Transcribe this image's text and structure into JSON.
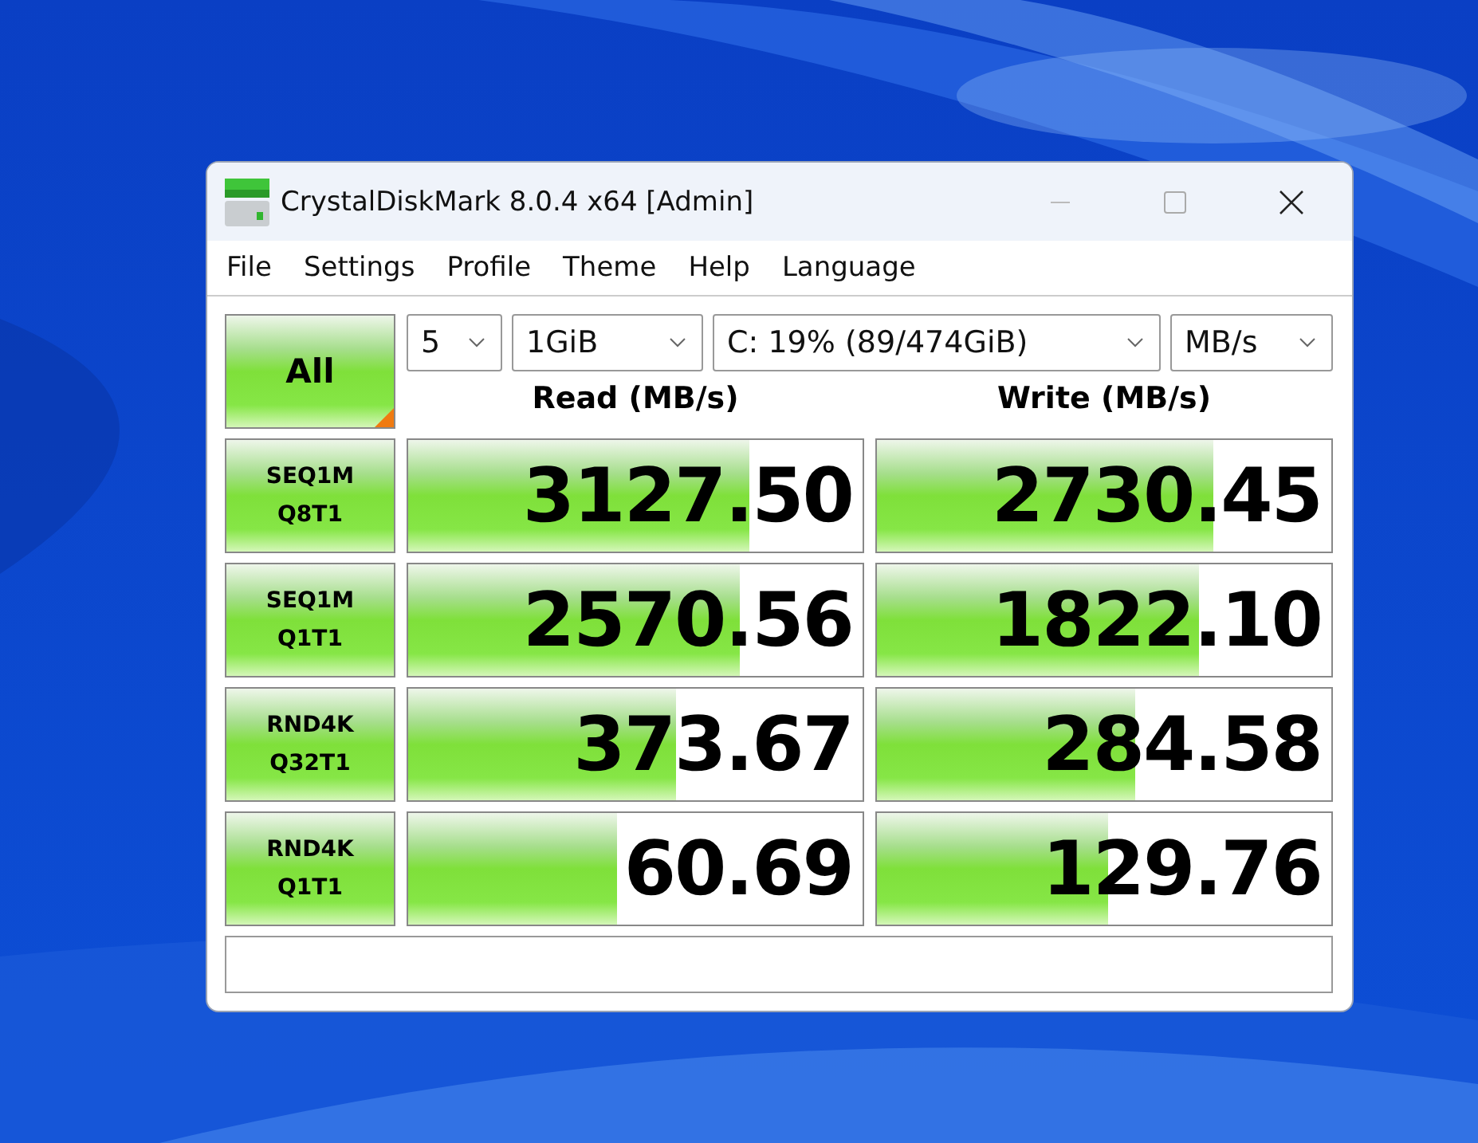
{
  "window": {
    "title": "CrystalDiskMark 8.0.4 x64 [Admin]"
  },
  "menu": [
    "File",
    "Settings",
    "Profile",
    "Theme",
    "Help",
    "Language"
  ],
  "all_button": {
    "label": "All"
  },
  "selects": [
    {
      "value": "5"
    },
    {
      "value": "1GiB"
    },
    {
      "value": "C: 19% (89/474GiB)"
    },
    {
      "value": "MB/s"
    }
  ],
  "headers": [
    "Read (MB/s)",
    "Write (MB/s)"
  ],
  "rows": [
    {
      "test": [
        "SEQ1M",
        "Q8T1"
      ],
      "read": {
        "value": "3127.50",
        "level": 0.75
      },
      "write": {
        "value": "2730.45",
        "level": 0.74
      }
    },
    {
      "test": [
        "SEQ1M",
        "Q1T1"
      ],
      "read": {
        "value": "2570.56",
        "level": 0.73
      },
      "write": {
        "value": "1822.10",
        "level": 0.71
      }
    },
    {
      "test": [
        "RND4K",
        "Q32T1"
      ],
      "read": {
        "value": "373.67",
        "level": 0.59
      },
      "write": {
        "value": "284.58",
        "level": 0.57
      }
    },
    {
      "test": [
        "RND4K",
        "Q1T1"
      ],
      "read": {
        "value": "60.69",
        "level": 0.46
      },
      "write": {
        "value": "129.76",
        "level": 0.51
      }
    }
  ]
}
